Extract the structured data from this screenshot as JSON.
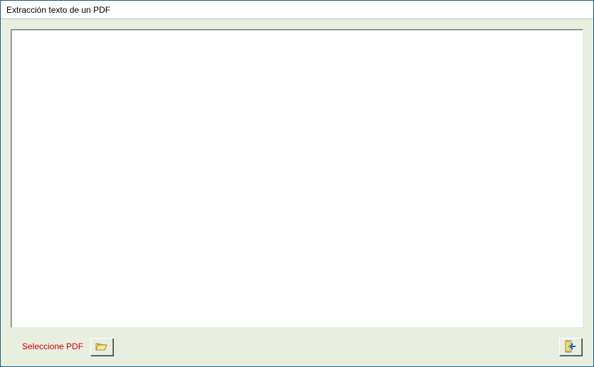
{
  "window": {
    "title": "Extracción texto de un PDF"
  },
  "output": {
    "text": ""
  },
  "actions": {
    "select_label": "Seleccione PDF"
  },
  "icons": {
    "open_folder": "open-folder-icon",
    "exit": "exit-door-icon"
  }
}
